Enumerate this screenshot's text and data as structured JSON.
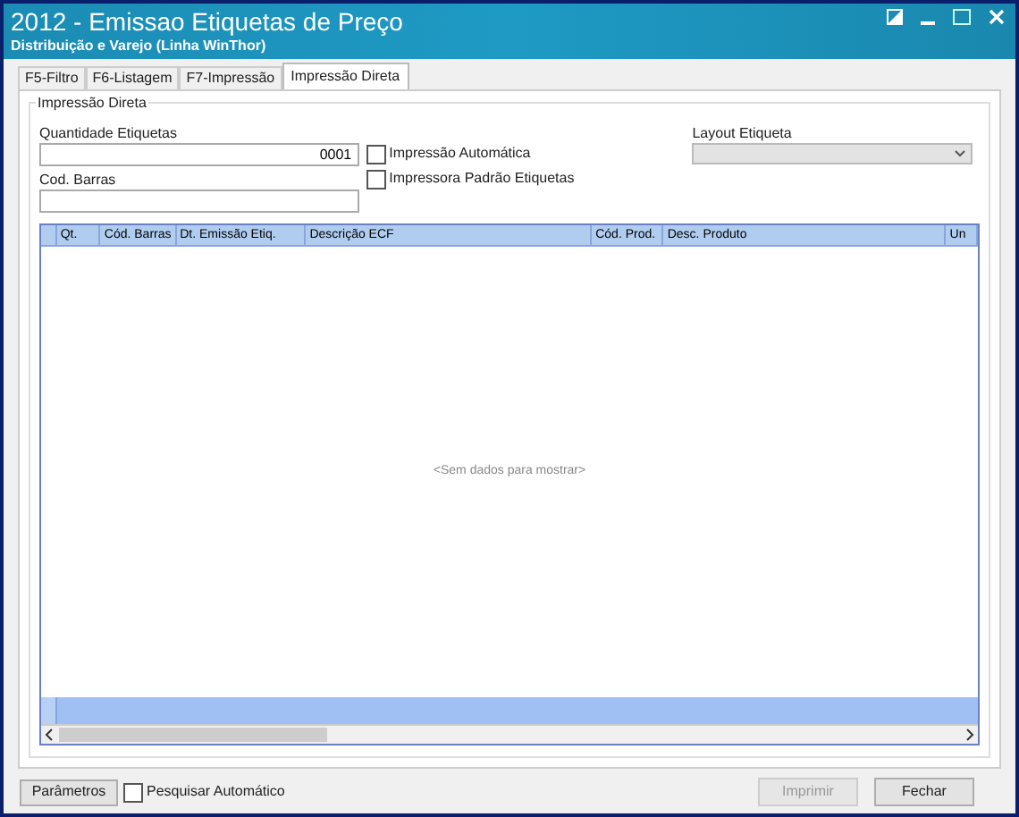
{
  "window": {
    "title": "2012 - Emissao Etiquetas de Preço",
    "subtitle": "Distribuição e Varejo (Linha WinThor)"
  },
  "tabs": [
    {
      "label": "F5-Filtro",
      "selected": false
    },
    {
      "label": "F6-Listagem",
      "selected": false
    },
    {
      "label": "F7-Impressão",
      "selected": false
    },
    {
      "label": "Impressão Direta",
      "selected": true
    }
  ],
  "group": {
    "title": "Impressão Direta"
  },
  "quantity": {
    "label": "Quantidade Etiquetas",
    "value": "0001"
  },
  "barcode": {
    "label": "Cod. Barras"
  },
  "options": [
    {
      "label": "Impressão Automática",
      "checked": false
    },
    {
      "label": "Impressora Padrão Etiquetas",
      "checked": false
    }
  ],
  "layout": {
    "label": "Layout Etiqueta"
  },
  "table": {
    "columns": [
      "Qt.",
      "Cód. Barras",
      "Dt. Emissão Etiq.",
      "Descrição ECF",
      "Cód. Prod.",
      "Desc. Produto",
      "Un"
    ],
    "empty_text": "<Sem dados para mostrar>"
  },
  "footer": {
    "params_button": "Parâmetros",
    "auto_search": {
      "label": "Pesquisar Automático",
      "checked": false
    },
    "buttons": [
      {
        "label": "Imprimir",
        "disabled": true
      },
      {
        "label": "Fechar",
        "disabled": false
      }
    ]
  }
}
